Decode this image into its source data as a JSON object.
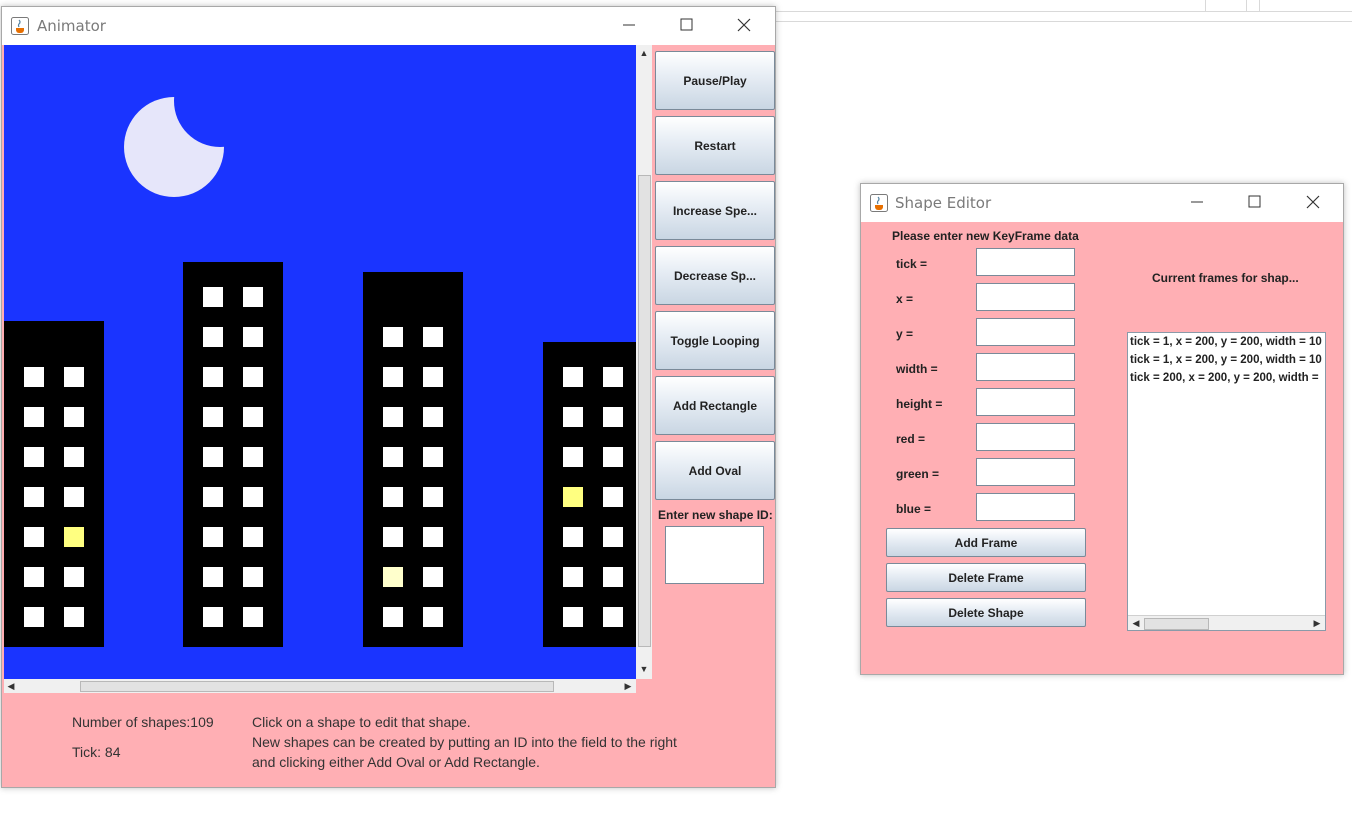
{
  "animator": {
    "title": "Animator",
    "controls": {
      "pause_play": "Pause/Play",
      "restart": "Restart",
      "increase_speed": "Increase Spe...",
      "decrease_speed": "Decrease Sp...",
      "toggle_looping": "Toggle Looping",
      "add_rectangle": "Add Rectangle",
      "add_oval": "Add Oval",
      "new_shape_id_label": "Enter new shape ID:",
      "new_shape_id_value": ""
    },
    "status": {
      "shape_count": "Number of shapes:109",
      "tick": "Tick: 84",
      "help_line1": "Click on a shape to edit that shape.",
      "help_line2": "New shapes can be created by putting an ID into the field to the right",
      "help_line3": "and clicking either Add Oval or Add Rectangle."
    },
    "colors": {
      "sky": "#1a34ff",
      "moon": "#e6e6fa",
      "panel": "#ffafb4",
      "lit_window": "#ffff80",
      "dim_window": "#ffffcc"
    }
  },
  "shape_editor": {
    "title": "Shape Editor",
    "prompt": "Please enter new KeyFrame data",
    "fields": [
      {
        "label": "tick =",
        "value": ""
      },
      {
        "label": "x =",
        "value": ""
      },
      {
        "label": "y =",
        "value": ""
      },
      {
        "label": "width =",
        "value": ""
      },
      {
        "label": "height =",
        "value": ""
      },
      {
        "label": "red =",
        "value": ""
      },
      {
        "label": "green =",
        "value": ""
      },
      {
        "label": "blue =",
        "value": ""
      }
    ],
    "buttons": {
      "add_frame": "Add Frame",
      "delete_frame": "Delete Frame",
      "delete_shape": "Delete Shape"
    },
    "frames_label": "Current frames for shap...",
    "frames": [
      "tick = 1, x = 200, y = 200, width = 10",
      "tick = 1, x = 200, y = 200, width = 10",
      "tick = 200, x = 200, y = 200, width ="
    ]
  }
}
